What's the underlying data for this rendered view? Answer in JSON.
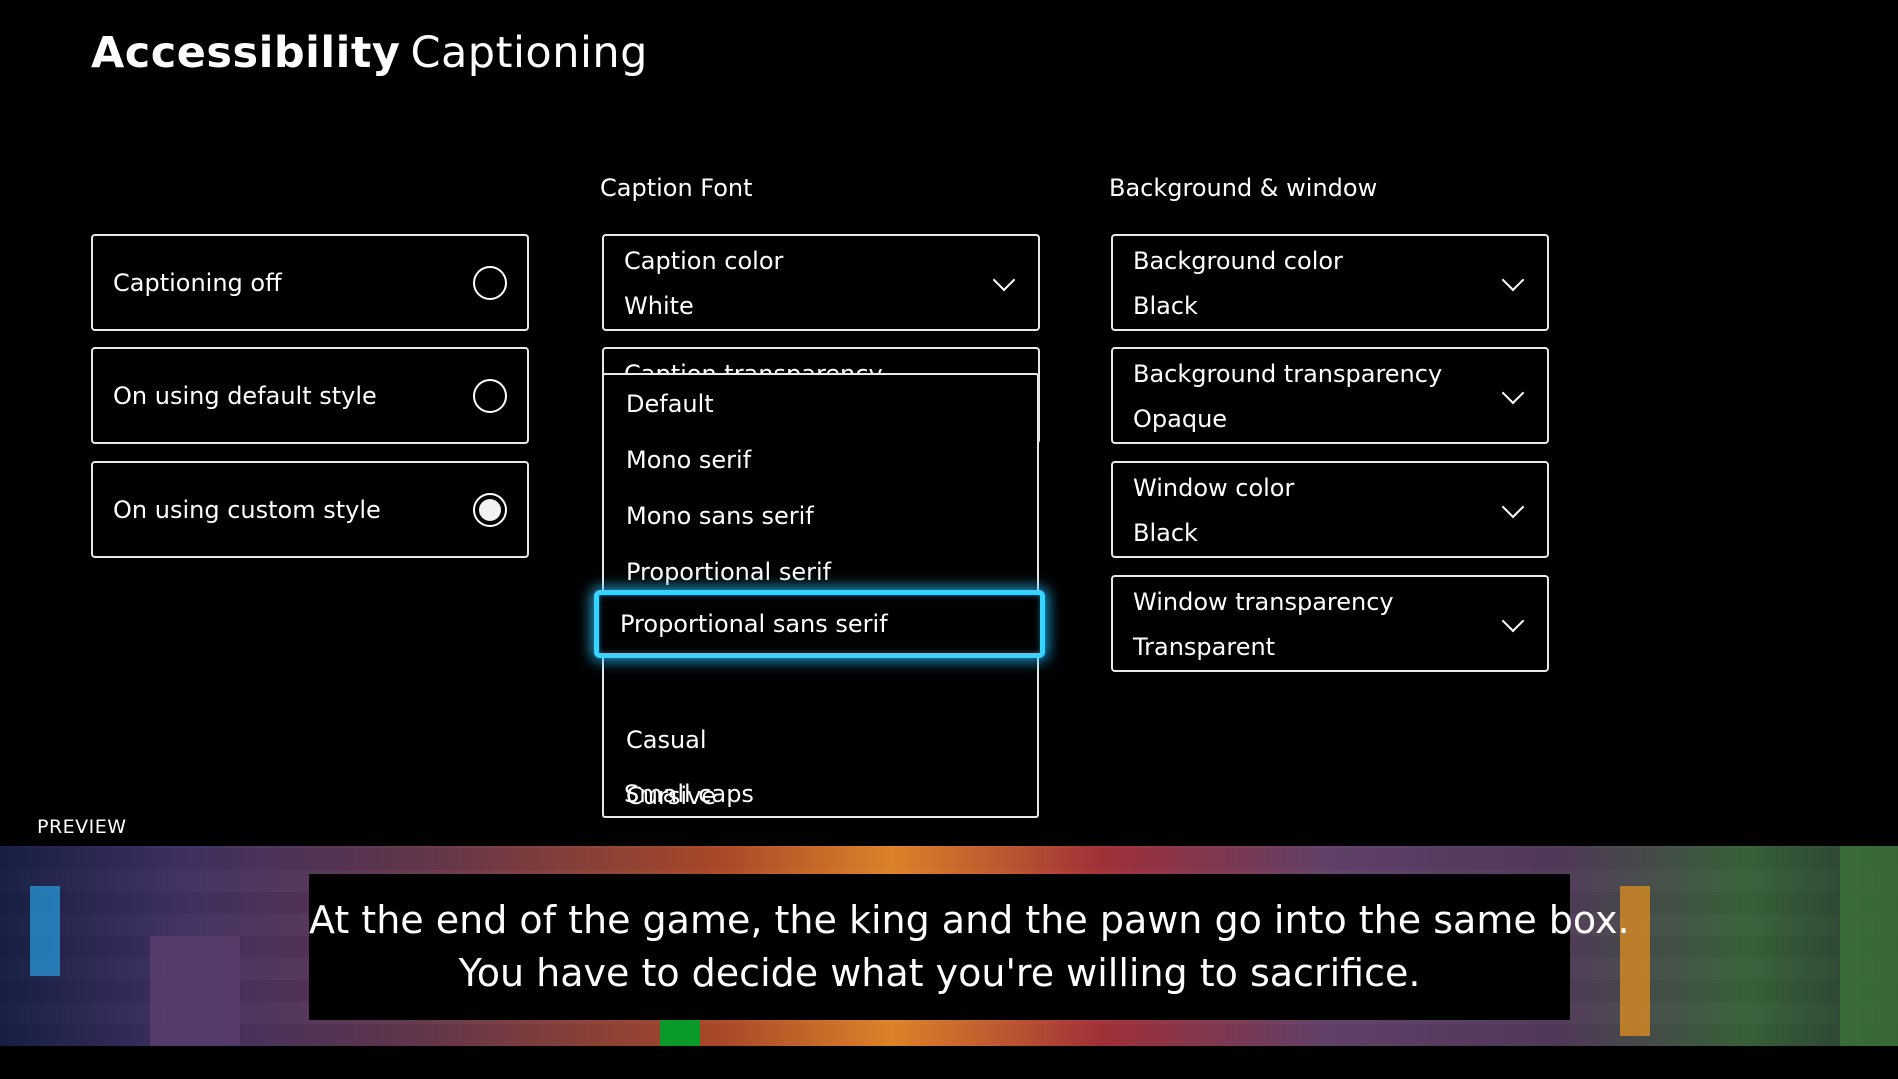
{
  "header": {
    "title_bold": "Accessibility",
    "title_light": "Captioning"
  },
  "captioning_modes": [
    {
      "label": "Captioning off",
      "selected": false
    },
    {
      "label": "On using default style",
      "selected": false
    },
    {
      "label": "On using custom style",
      "selected": true
    }
  ],
  "caption_font": {
    "heading": "Caption Font",
    "caption_color": {
      "label": "Caption color",
      "value": "White"
    },
    "caption_transparency": {
      "label": "Caption transparency"
    },
    "font_dropdown": {
      "options": [
        "Default",
        "Mono serif",
        "Mono sans serif",
        "Proportional serif",
        "Proportional sans serif",
        "Casual",
        "Cursive",
        "Small caps"
      ],
      "focused": "Proportional sans serif"
    }
  },
  "background_window": {
    "heading": "Background & window",
    "items": [
      {
        "label": "Background color",
        "value": "Black"
      },
      {
        "label": "Background transparency",
        "value": "Opaque"
      },
      {
        "label": "Window color",
        "value": "Black"
      },
      {
        "label": "Window transparency",
        "value": "Transparent"
      }
    ]
  },
  "preview": {
    "label": "PREVIEW",
    "caption_lines": [
      "At the end of the game, the king and the pawn go into the same box.",
      "You have to decide what you're willing to sacrifice."
    ]
  },
  "colors": {
    "focus": "#3ad3ff",
    "background": "#000000",
    "text": "#ffffff"
  }
}
